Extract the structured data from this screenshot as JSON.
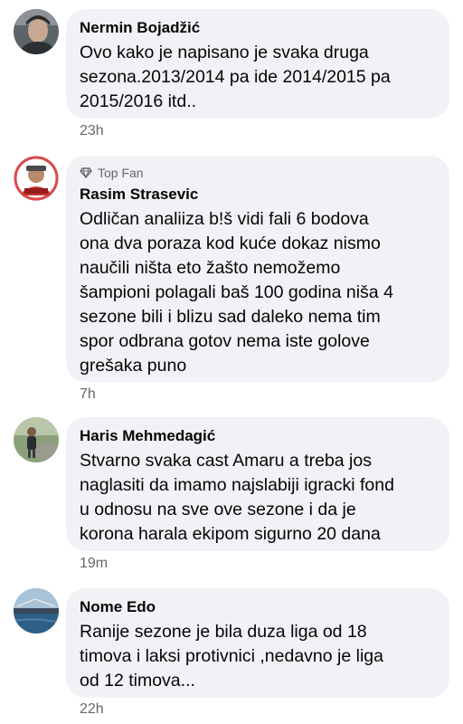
{
  "comments": [
    {
      "author": "Nermin Bojadžić",
      "top_fan": "",
      "text": "Ovo kako je napisano je svaka druga\nsezona.2013/2014 pa ide 2014/2015  pa\n2015/2016 itd..",
      "time": "23h"
    },
    {
      "author": "Rasim Strasevic",
      "top_fan": "Top Fan",
      "text": "Odličan analiiza  b!š vidi fali 6 bodova\nona dva poraza  kod kuće dokaz nismo\nnaučili  ništa eto žašto nemožemo\nšampioni polagali baš 100 godina  niša 4\nsezone  bili i blizu sad daleko nema tim\nspor odbrana  gotov nema iste golove\ngrešaka puno",
      "time": "7h"
    },
    {
      "author": "Haris Mehmedagić",
      "top_fan": "",
      "text": "Stvarno svaka cast Amaru a treba jos\nnaglasiti da imamo najslabiji igracki fond\nu odnosu na sve ove sezone i da je\nkorona harala ekipom sigurno 20 dana",
      "time": "19m"
    },
    {
      "author": "Nome Edo",
      "top_fan": "",
      "text": "Ranije sezone je bila duza liga od 18\ntimova i laksi protivnici ,nedavno je liga\nod 12 timova...",
      "time": "22h"
    }
  ],
  "avatar_icons": [
    "avatar-photo-icon",
    "avatar-logo-icon",
    "avatar-photo-icon",
    "avatar-landscape-icon"
  ],
  "colors": {
    "bubble": "#f0f2f5",
    "text": "#050505",
    "secondary": "#65676b"
  }
}
